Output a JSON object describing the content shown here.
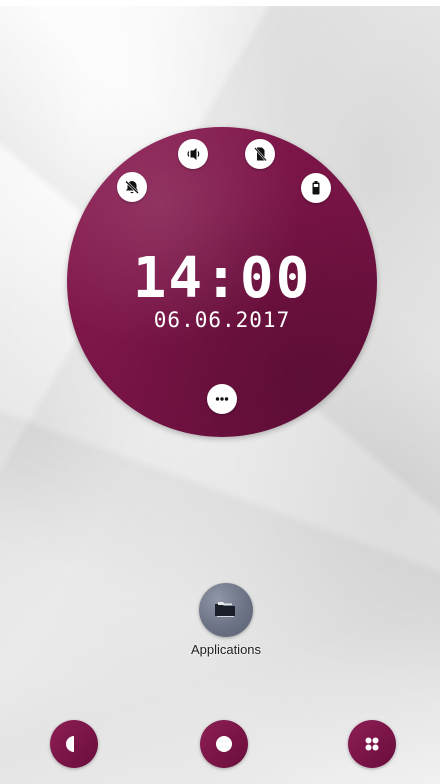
{
  "clock": {
    "time": "14:00",
    "date": "06.06.2017"
  },
  "status_icons": [
    {
      "name": "alarm-off-icon"
    },
    {
      "name": "volume-icon"
    },
    {
      "name": "sim-off-icon"
    },
    {
      "name": "battery-icon"
    }
  ],
  "more_button": {
    "icon": "more-horizontal-icon"
  },
  "app_launcher": {
    "label": "Applications",
    "icon": "folder-icon"
  },
  "dock": {
    "left_icon": "half-circle-icon",
    "center_icon": "circle-icon",
    "right_icon": "grid-dots-icon"
  },
  "colors": {
    "accent": "#7a1447",
    "launcher": "#6c7384",
    "background": "#f2f2f2"
  }
}
